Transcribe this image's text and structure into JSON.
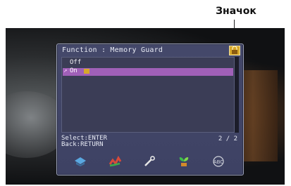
{
  "callout": {
    "label": "Значок"
  },
  "osd": {
    "title": "Function : Memory Guard",
    "items": [
      {
        "label": "Off",
        "selected": false
      },
      {
        "label": "On",
        "selected": true,
        "lock": true
      }
    ],
    "help": {
      "line1": "Select:ENTER",
      "line2": "Back:RETURN"
    },
    "page": "2 / 2",
    "icons": [
      "input-icon",
      "sound-icon",
      "setup-wrench-icon",
      "eco-icon",
      "language-icon"
    ]
  },
  "colors": {
    "panel": "#44486a",
    "highlight": "#a060b8",
    "lock": "#d7a82a"
  }
}
